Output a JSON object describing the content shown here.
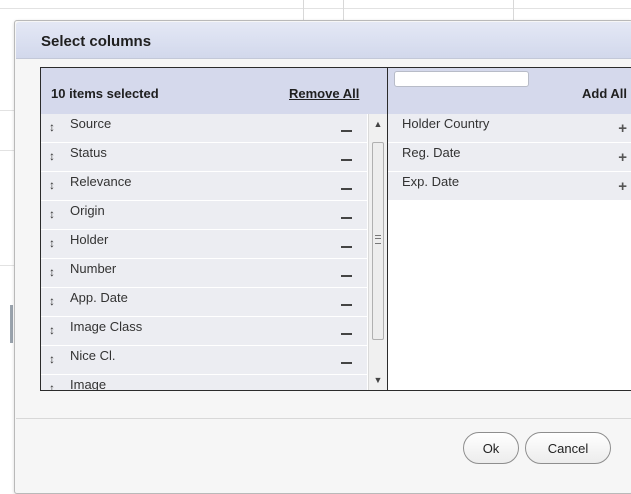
{
  "dialog": {
    "title": "Select columns",
    "ok_label": "Ok",
    "cancel_label": "Cancel"
  },
  "left_panel": {
    "selected_count": "10 items selected",
    "remove_all_label": "Remove All",
    "items": [
      {
        "label": "Source"
      },
      {
        "label": "Status"
      },
      {
        "label": "Relevance"
      },
      {
        "label": "Origin"
      },
      {
        "label": "Holder"
      },
      {
        "label": "Number"
      },
      {
        "label": "App. Date"
      },
      {
        "label": "Image Class"
      },
      {
        "label": "Nice Cl."
      },
      {
        "label": "Image"
      }
    ],
    "handle_glyph": "↕"
  },
  "right_panel": {
    "search_value": "",
    "add_all_label": "Add All",
    "items": [
      {
        "label": "Holder Country"
      },
      {
        "label": "Reg. Date"
      },
      {
        "label": "Exp. Date"
      }
    ],
    "add_glyph": "+"
  },
  "icons": {
    "scroll_up": "▲",
    "scroll_down": "▼"
  }
}
